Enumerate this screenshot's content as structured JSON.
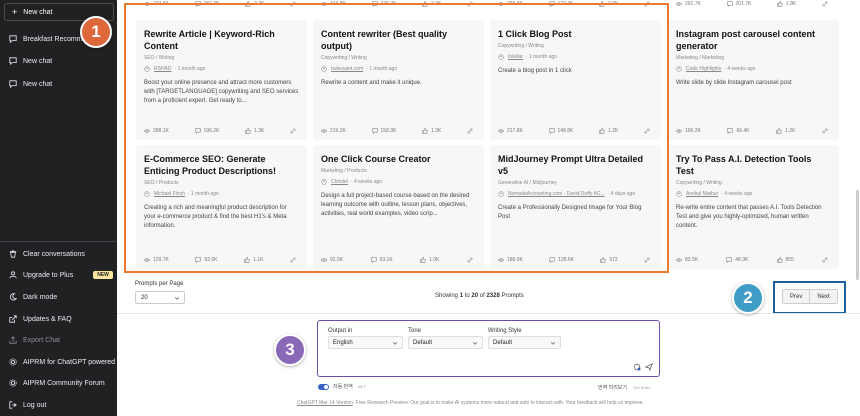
{
  "sidebar": {
    "new_chat": "New chat",
    "chats": [
      "Breakfast Recommen",
      "New chat",
      "New chat"
    ],
    "bottom_items": [
      {
        "label": "Clear conversations",
        "icon": "trash-icon"
      },
      {
        "label": "Upgrade to Plus",
        "icon": "user-icon",
        "badge": "NEW"
      },
      {
        "label": "Dark mode",
        "icon": "moon-icon"
      },
      {
        "label": "Updates & FAQ",
        "icon": "external-link-icon"
      },
      {
        "label": "Export Chat",
        "icon": "export-icon"
      },
      {
        "label": "AIPRM for ChatGPT powered",
        "icon": "gear-icon"
      },
      {
        "label": "AIPRM Community Forum",
        "icon": "gear-icon"
      },
      {
        "label": "Log out",
        "icon": "logout-icon"
      }
    ]
  },
  "top_stats": [
    {
      "views": "274.6K",
      "uses": "187.4K",
      "likes": "2.2K"
    },
    {
      "views": "413.8K",
      "uses": "276.7K",
      "likes": "2.2K"
    },
    {
      "views": "265.3K",
      "uses": "172.4K",
      "likes": "2.0K"
    },
    {
      "views": "291.7K",
      "uses": "201.7K",
      "likes": "1.8K"
    }
  ],
  "cards": [
    {
      "title": "Rewrite Article | Keyword-Rich Content",
      "category": "SEO / Writing",
      "author": "RSHAD",
      "time": "1 month ago",
      "desc": "Boost your online presence and attract more customers with [TARGETLANGUAGE] copywriting and SEO services from a proficient expert. Get ready to...",
      "views": "288.1K",
      "uses": "196.2K",
      "likes": "1.3K"
    },
    {
      "title": "Content rewriter (Best quality output)",
      "category": "Copywriting / Writing",
      "author": "bulavyant.com",
      "time": "1 month ago",
      "desc": "Rewrite a content and make it unique.",
      "views": "219.2K",
      "uses": "158.3K",
      "likes": "1.3K"
    },
    {
      "title": "1 Click Blog Post",
      "category": "Copywriting / Writing",
      "author": "Intellar",
      "time": "1 month ago",
      "desc": "Create a blog post in 1 click",
      "views": "217.8K",
      "uses": "148.8K",
      "likes": "1.2K"
    },
    {
      "title": "Instagram post carousel content generator",
      "category": "Marketing / Marketing",
      "author": "Code Highlights",
      "time": "4 weeks ago",
      "desc": "Write slide by slide Instagram carousel post",
      "views": "106.2K",
      "uses": "66.4K",
      "likes": "1.2K"
    },
    {
      "title": "E-Commerce SEO: Generate Enticing Product Descriptions!",
      "category": "SEO / Products",
      "author": "Michael Finch",
      "time": "1 month ago",
      "desc": "Creating a rich and meaningful product description for your e-commerce product & find the best H1's & Meta information.",
      "views": "129.7K",
      "uses": "92.6K",
      "likes": "1.1K"
    },
    {
      "title": "One Click Course Creator",
      "category": "Marketing / Products",
      "author": "Christel",
      "time": "4 weeks ago",
      "desc": "Design a full project-based course based on the desired learning outcome with outline, lesson plans, objectives, activities, real world examples, video scrip...",
      "views": "92.5K",
      "uses": "53.1K",
      "likes": "1.0K"
    },
    {
      "title": "MidJourney Prompt Ultra Detailed v5",
      "category": "Generative AI / Midjourney",
      "author": "NomadsAccounting.com - David Duffy AC...",
      "time": "4 days ago",
      "desc": "Create a Professionally Designed Image for Your Blog Post",
      "views": "188.0K",
      "uses": "128.6K",
      "likes": "972"
    },
    {
      "title": "Try To Pass A.I. Detection Tools Test",
      "category": "Copywriting / Writing",
      "author": "Anshul Mathur",
      "time": "4 weeks ago",
      "desc": "Re-write entire content that passes A.I. Tools Detection Test and give you highly-optimized, human written content.",
      "views": "83.5K",
      "uses": "48.3K",
      "likes": "855"
    }
  ],
  "pagination": {
    "prompts_per_page_label": "Prompts per Page",
    "per_page_value": "20",
    "showing_prefix": "Showing",
    "from": "1",
    "to_word": "to",
    "to": "20",
    "of_word": "of",
    "total": "2328",
    "suffix": "Prompts",
    "prev": "Prev",
    "next": "Next"
  },
  "composer": {
    "output_label": "Output in",
    "output_value": "English",
    "tone_label": "Tone",
    "tone_value": "Default",
    "style_label": "Writing Style",
    "style_value": "Default"
  },
  "toggles": {
    "auto_translate": "자동 번역",
    "auto_translate_shortcut": "Alt T",
    "preview": "번역 미리보기",
    "preview_shortcut": "Ctrl Enter"
  },
  "footer": {
    "link": "ChatGPT Mar 14 Version",
    "text": ". Free Research Preview. Our goal is to make AI systems more natural and safe to interact with. Your feedback will help us improve."
  },
  "callouts": {
    "one": "1",
    "two": "2",
    "three": "3"
  },
  "colors": {
    "sidebar": "#202123",
    "orange": "#ec7a2d",
    "blue": "#1a5f9e",
    "purple": "#6c4ea5"
  }
}
